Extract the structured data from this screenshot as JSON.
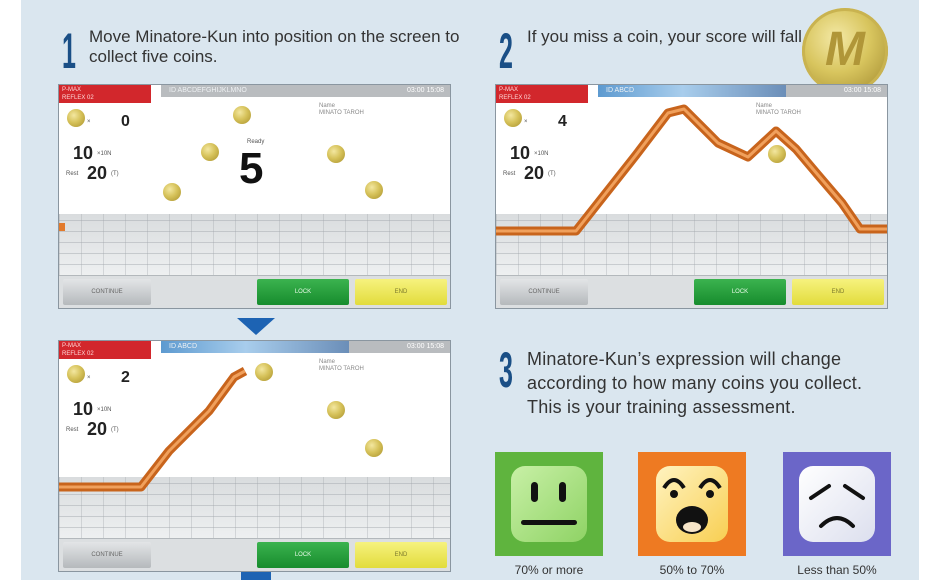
{
  "steps": [
    {
      "number": "1",
      "text": "Move Minatore-Kun into position on the screen to collect five coins."
    },
    {
      "number": "2",
      "text": "If you miss a coin, your score will fall."
    },
    {
      "number": "3",
      "text": "Minatore-Kun’s expression will change according to how many coins you collect. This is your training assessment."
    }
  ],
  "coin_badge_label": "M",
  "screens": [
    {
      "header_left": "P-MAX\nREFLEX 02",
      "header_mid": "ID ABCDEFGHIJKLMNO",
      "header_time": "03:00  15:08",
      "name_label": "Name\nMINATO TAROH",
      "coins_collected": "0",
      "multiplier": "10",
      "multiplier_unit": "×10N",
      "rest_label": "Rest",
      "rest_value": "20",
      "rest_unit": "(T)",
      "ready_label": "Ready",
      "countdown": "5",
      "btn_continue": "CONTINUE",
      "btn_lock": "LOCK",
      "btn_end": "END"
    },
    {
      "header_left": "P-MAX\nREFLEX 02",
      "header_mid": "ID ABCD",
      "header_time": "03:00  15:08",
      "name_label": "Name\nMINATO TAROH",
      "coins_collected": "4",
      "multiplier": "10",
      "multiplier_unit": "×10N",
      "rest_label": "Rest",
      "rest_value": "20",
      "rest_unit": "(T)",
      "btn_continue": "CONTINUE",
      "btn_lock": "LOCK",
      "btn_end": "END"
    },
    {
      "header_left": "P-MAX\nREFLEX 02",
      "header_mid": "ID ABCD",
      "header_time": "03:00  15:08",
      "name_label": "Name\nMINATO TAROH",
      "coins_collected": "2",
      "multiplier": "10",
      "multiplier_unit": "×10N",
      "rest_label": "Rest",
      "rest_value": "20",
      "rest_unit": "(T)",
      "btn_continue": "CONTINUE",
      "btn_lock": "LOCK",
      "btn_end": "END"
    }
  ],
  "faces": [
    {
      "caption": "70% or more",
      "icon": "smile-face-icon"
    },
    {
      "caption": "50% to 70%",
      "icon": "laughing-face-icon"
    },
    {
      "caption": "Less than 50%",
      "icon": "sad-face-icon"
    }
  ],
  "colors": {
    "panel_bg": "#dae6ef",
    "step_number": "#1a4f86",
    "arrow": "#1d63b3",
    "track_orange": "#e27a2c",
    "face_green": "#5fb43e",
    "face_orange": "#ee7a22",
    "face_purple": "#6b66c8"
  }
}
